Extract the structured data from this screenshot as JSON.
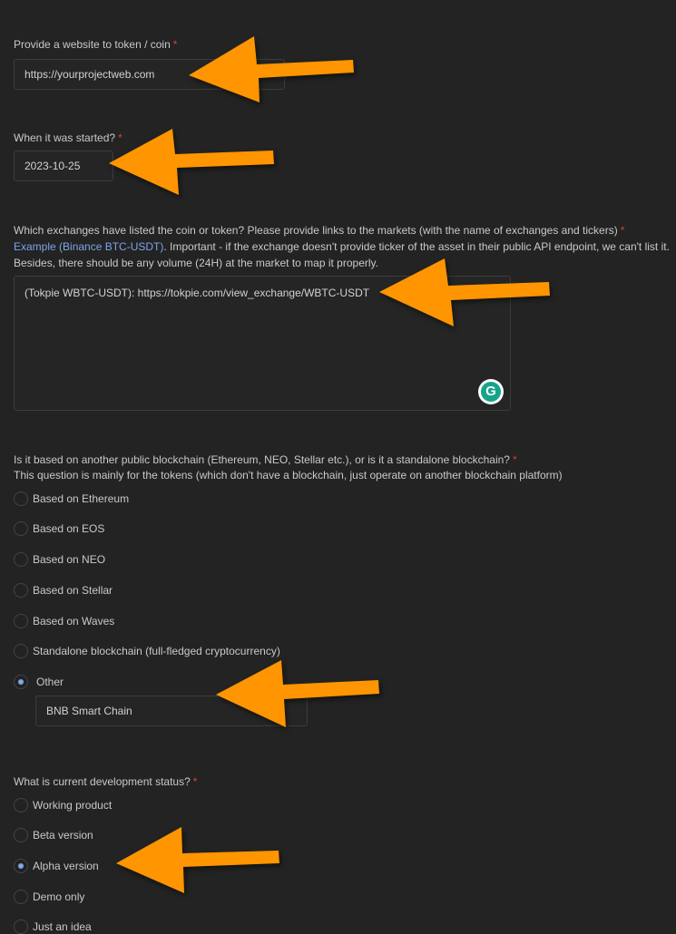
{
  "website": {
    "label": "Provide a website to token / coin",
    "required": "*",
    "value": "https://yourprojectweb.com"
  },
  "started": {
    "label": "When it was started?",
    "required": "*",
    "value": "2023-10-25"
  },
  "exchanges": {
    "label": "Which exchanges have listed the coin or token? Please provide links to the markets (with the name of exchanges and tickers)",
    "required": "*",
    "link": "Example (Binance BTC-USDT)",
    "note1": ". Important - if the exchange doesn't provide ticker of the asset in their public API endpoint, we can't list it.",
    "note2": "Besides, there should be any volume (24H) at the market to map it properly.",
    "value": "(Tokpie WBTC-USDT): https://tokpie.com/view_exchange/WBTC-USDT"
  },
  "blockchain": {
    "label": "Is it based on another public blockchain (Ethereum, NEO, Stellar etc.), or is it a standalone blockchain?",
    "required": "*",
    "hint": "This question is mainly for the tokens (which don't have a blockchain, just operate on another blockchain platform)",
    "options": [
      "Based on Ethereum",
      "Based on EOS",
      "Based on NEO",
      "Based on Stellar",
      "Based on Waves",
      "Standalone blockchain (full-fledged cryptocurrency)",
      "Other"
    ],
    "selected": "Other",
    "other_value": "BNB Smart Chain"
  },
  "status": {
    "label": "What is current development status?",
    "required": "*",
    "options": [
      "Working product",
      "Beta version",
      "Alpha version",
      "Demo only",
      "Just an idea"
    ],
    "selected": "Alpha version"
  },
  "colors": {
    "arrow": "#ff9500",
    "background": "#232323",
    "link": "#7ea3e8",
    "required": "#d9413a",
    "grammarly": "#15a38a"
  }
}
